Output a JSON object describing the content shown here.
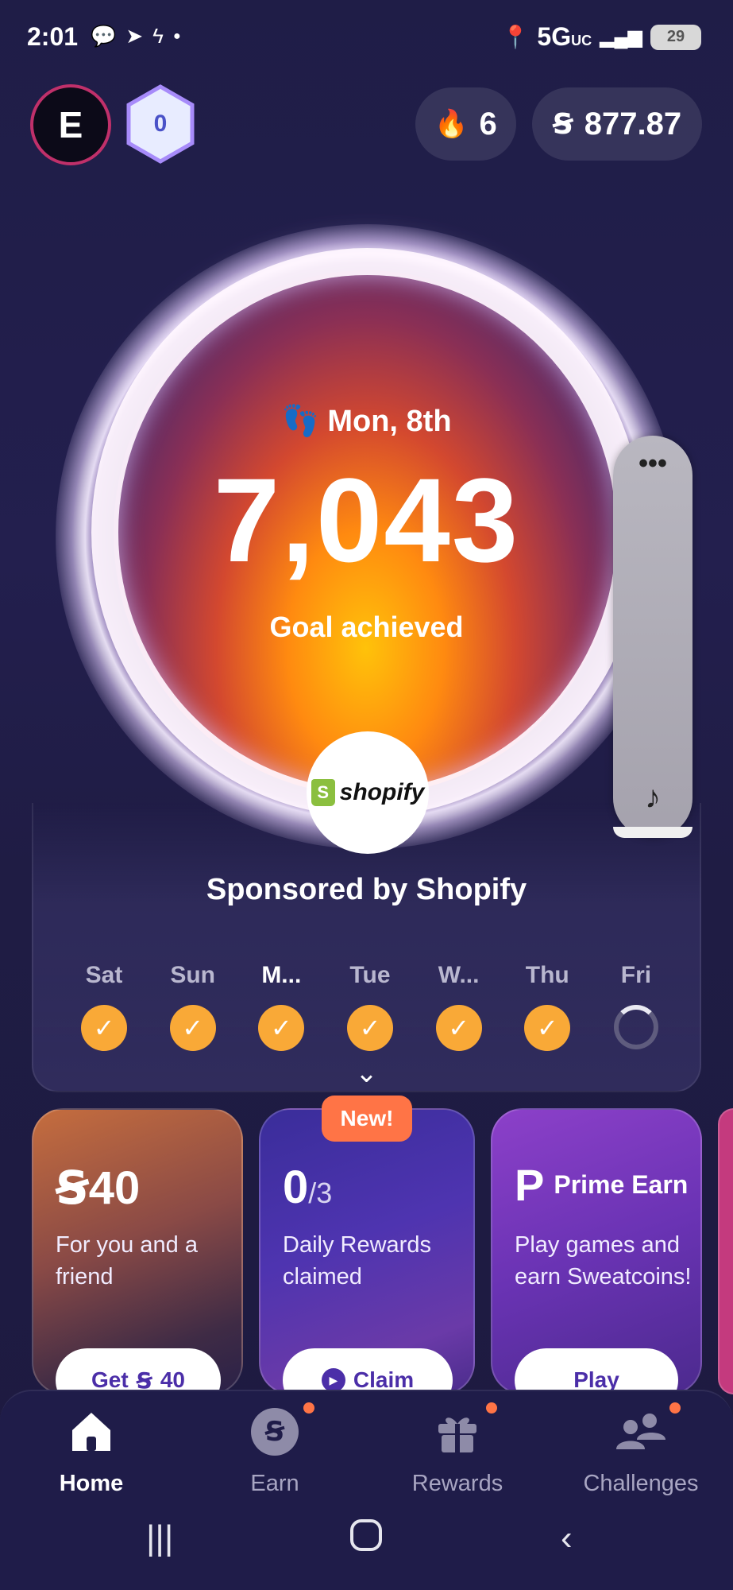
{
  "status_bar": {
    "time": "2:01",
    "network": "5G",
    "network_suffix": "UC",
    "battery": "29"
  },
  "header": {
    "avatar_initial": "E",
    "level": "0",
    "streak": "6",
    "balance": "877.87"
  },
  "today": {
    "date": "Mon, 8th",
    "steps": "7,043",
    "status": "Goal achieved"
  },
  "sponsor": {
    "logo_text": "shopify",
    "text": "Sponsored by Shopify"
  },
  "side_panel": {
    "menu": "•••"
  },
  "week": [
    {
      "label": "Sat",
      "done": true
    },
    {
      "label": "Sun",
      "done": true
    },
    {
      "label": "M...",
      "done": true,
      "today": true
    },
    {
      "label": "Tue",
      "done": true
    },
    {
      "label": "W...",
      "done": true
    },
    {
      "label": "Thu",
      "done": true
    },
    {
      "label": "Fri",
      "done": false
    }
  ],
  "promos": {
    "invite": {
      "amount": "40",
      "desc": "For you and a friend",
      "button": "Get",
      "button_amount": "40"
    },
    "daily": {
      "badge": "New!",
      "count": "0",
      "total": "/3",
      "desc": "Daily Rewards claimed",
      "button": "Claim"
    },
    "prime": {
      "title": "Prime Earn",
      "desc": "Play games and earn Sweatcoins!",
      "button": "Play"
    }
  },
  "nav": {
    "items": [
      {
        "label": "Home",
        "icon": "home-icon",
        "active": true
      },
      {
        "label": "Earn",
        "icon": "sweatcoin-icon",
        "badge": true
      },
      {
        "label": "Rewards",
        "icon": "gift-icon",
        "badge": true
      },
      {
        "label": "Challenges",
        "icon": "people-icon",
        "badge": true
      }
    ]
  },
  "colors": {
    "background": "#1f1d47",
    "accent_orange": "#ff7446",
    "check": "#f9a937",
    "button_text": "#4b2ea8"
  }
}
